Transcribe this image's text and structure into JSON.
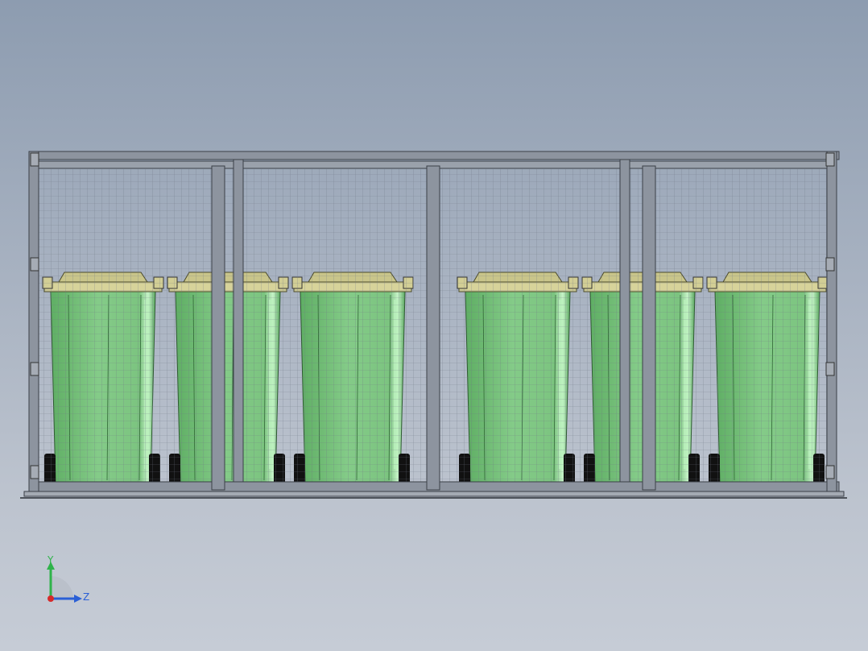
{
  "viewport": {
    "background_top": "#8d9cb0",
    "background_bottom": "#c6ccd6",
    "model": {
      "frame_color": "#8d949f",
      "frame_edge": "#3a3f47",
      "mesh_color": "#6e7784",
      "bin_body": "#7fc783",
      "bin_highlight": "#b9f0bc",
      "bin_shadow": "#4f9c56",
      "bin_lid": "#d7d39a",
      "wheel_color": "#111111",
      "bin_count": 6,
      "post_count": 5
    }
  },
  "triad": {
    "y_label": "Y",
    "z_label": "Z",
    "y_color": "#2fb34a",
    "z_color": "#2a5fd6",
    "x_color": "#d62a2a"
  }
}
